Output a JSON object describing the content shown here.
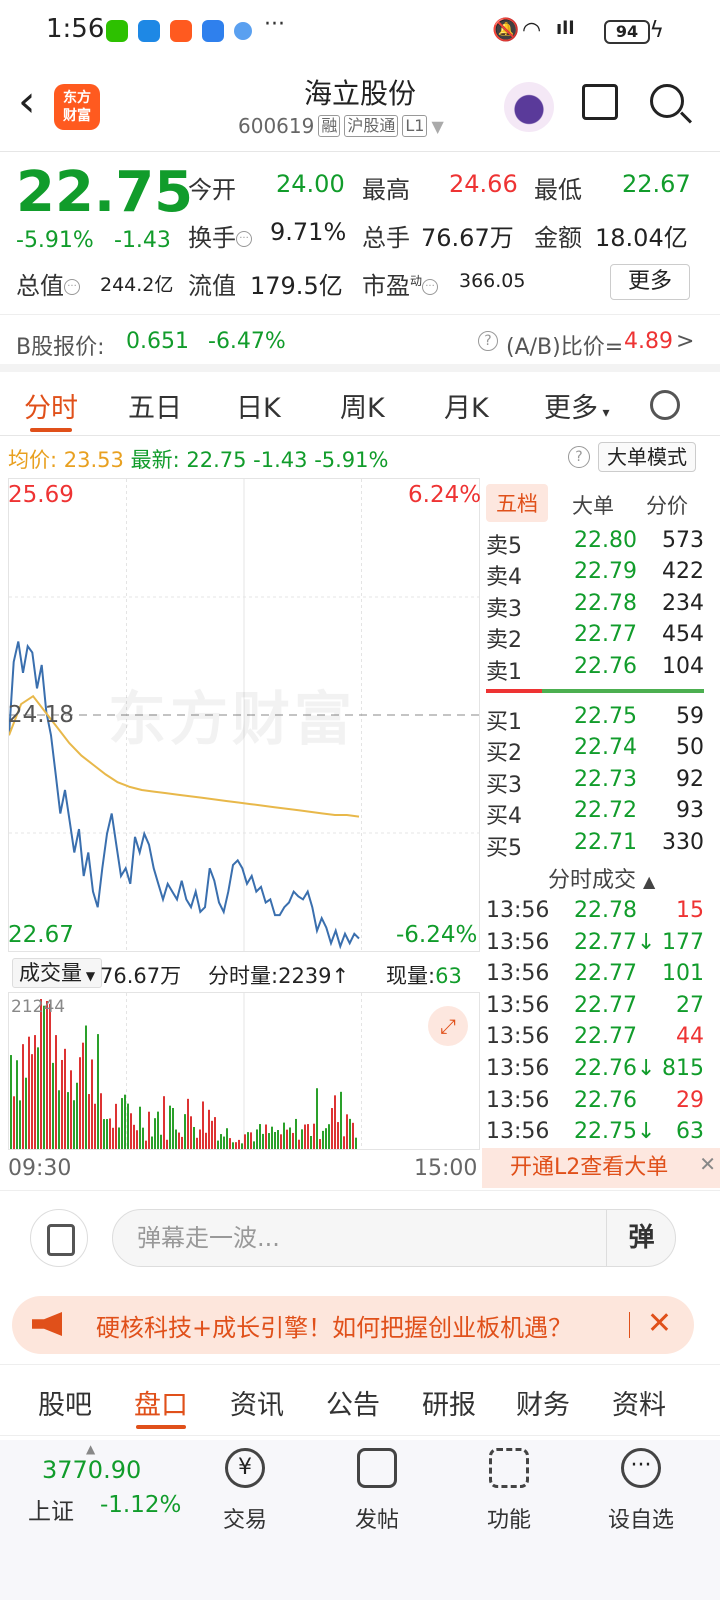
{
  "status_bar": {
    "time": "1:56",
    "battery": "94",
    "more": "···"
  },
  "header": {
    "title": "海立股份",
    "code": "600619",
    "tag_margin": "融",
    "tag_connect": "沪股通",
    "tag_level": "L1",
    "logo_line1": "东方",
    "logo_line2": "财富"
  },
  "quote": {
    "price": "22.75",
    "change_pct": "-5.91%",
    "change": "-1.43",
    "open_label": "今开",
    "open": "24.00",
    "high_label": "最高",
    "high": "24.66",
    "low_label": "最低",
    "low": "22.67",
    "turnover_label": "换手",
    "turnover": "9.71%",
    "volume_label": "总手",
    "volume": "76.67万",
    "amount_label": "金额",
    "amount": "18.04亿",
    "mktcap_label": "总值",
    "mktcap": "244.2亿",
    "float_label": "流值",
    "float": "179.5亿",
    "pe_label": "市盈",
    "pe_sup": "动",
    "pe": "366.05",
    "more_button": "更多"
  },
  "b_share": {
    "label": "B股报价:",
    "price": "0.651",
    "pct": "-6.47%",
    "ratio_label": "(A/B)比价=",
    "ratio": "4.89",
    "arrow": ">"
  },
  "chart_tabs": [
    "分时",
    "五日",
    "日K",
    "周K",
    "月K",
    "更多"
  ],
  "summary": {
    "avg_label": "均价:",
    "avg": "23.53",
    "latest_label": "最新:",
    "latest": "22.75",
    "chg": "-1.43",
    "pct": "-5.91%",
    "big_order_btn": "大单模式"
  },
  "chart_labels": {
    "top_price": "25.69",
    "top_pct": "6.24%",
    "mid_price": "24.18",
    "bottom_price": "22.67",
    "bottom_pct": "-6.24%",
    "watermark": "东方财富"
  },
  "chart_data": {
    "type": "line",
    "x_range": [
      "09:30",
      "15:00"
    ],
    "ylim": [
      22.67,
      25.69
    ],
    "prev_close": 24.18,
    "series": [
      {
        "name": "price",
        "color": "#3a6fae",
        "values": [
          24.05,
          24.52,
          24.65,
          24.45,
          24.62,
          24.58,
          24.35,
          24.5,
          24.2,
          24.05,
          23.8,
          23.55,
          23.7,
          23.5,
          23.3,
          23.45,
          23.15,
          23.3,
          23.05,
          22.95,
          23.2,
          23.42,
          23.55,
          23.35,
          23.15,
          23.2,
          23.1,
          23.4,
          23.3,
          23.42,
          23.35,
          23.2,
          23.1,
          23.0,
          23.1,
          23.05,
          23.0,
          23.12,
          23.0,
          22.95,
          23.05,
          22.92,
          22.95,
          23.2,
          23.12,
          22.98,
          22.92,
          23.05,
          23.22,
          23.25,
          23.2,
          23.1,
          23.15,
          23.05,
          23.08,
          22.98,
          23.0,
          22.9,
          22.9,
          22.95,
          22.98,
          23.05,
          23.02,
          23.0,
          23.05,
          22.95,
          22.8,
          22.88,
          22.82,
          22.72,
          22.8,
          22.7,
          22.78,
          22.72,
          22.78,
          22.75
        ]
      },
      {
        "name": "avg",
        "color": "#e8b84a",
        "values": [
          24.05,
          24.25,
          24.3,
          24.2,
          24.1,
          24.0,
          23.92,
          23.86,
          23.8,
          23.75,
          23.72,
          23.7,
          23.69,
          23.68,
          23.67,
          23.66,
          23.65,
          23.64,
          23.63,
          23.62,
          23.61,
          23.6,
          23.59,
          23.58,
          23.57,
          23.56,
          23.55,
          23.54,
          23.54,
          23.53
        ]
      }
    ],
    "volume": {
      "label": "成交量",
      "total": "76.67万",
      "minute_label": "分时量:",
      "minute": "2239",
      "current_label": "现量:",
      "current": "63",
      "max_label": "21244",
      "max": 21244
    },
    "grid": true
  },
  "order_book": {
    "tabs": [
      "五档",
      "大单",
      "分价"
    ],
    "asks": [
      {
        "label": "卖5",
        "price": "22.80",
        "vol": "573"
      },
      {
        "label": "卖4",
        "price": "22.79",
        "vol": "422"
      },
      {
        "label": "卖3",
        "price": "22.78",
        "vol": "234"
      },
      {
        "label": "卖2",
        "price": "22.77",
        "vol": "454"
      },
      {
        "label": "卖1",
        "price": "22.76",
        "vol": "104"
      }
    ],
    "bids": [
      {
        "label": "买1",
        "price": "22.75",
        "vol": "59"
      },
      {
        "label": "买2",
        "price": "22.74",
        "vol": "50"
      },
      {
        "label": "买3",
        "price": "22.73",
        "vol": "92"
      },
      {
        "label": "买4",
        "price": "22.72",
        "vol": "93"
      },
      {
        "label": "买5",
        "price": "22.71",
        "vol": "330"
      }
    ],
    "ticks_header": "分时成交",
    "ticks": [
      {
        "time": "13:56",
        "price": "22.78",
        "vol": "15",
        "color": "#e33"
      },
      {
        "time": "13:56",
        "price": "22.77↓",
        "vol": "177",
        "color": "#119c2b"
      },
      {
        "time": "13:56",
        "price": "22.77",
        "vol": "101",
        "color": "#119c2b"
      },
      {
        "time": "13:56",
        "price": "22.77",
        "vol": "27",
        "color": "#119c2b"
      },
      {
        "time": "13:56",
        "price": "22.77",
        "vol": "44",
        "color": "#e33"
      },
      {
        "time": "13:56",
        "price": "22.76↓",
        "vol": "815",
        "color": "#119c2b"
      },
      {
        "time": "13:56",
        "price": "22.76",
        "vol": "29",
        "color": "#e33"
      },
      {
        "time": "13:56",
        "price": "22.75↓",
        "vol": "63",
        "color": "#119c2b"
      }
    ],
    "l2_promo": "开通L2查看大单",
    "l2_close": "✕"
  },
  "time_axis": {
    "start": "09:30",
    "end": "15:00"
  },
  "danmaku": {
    "placeholder": "弹幕走一波...",
    "button": "弹"
  },
  "banner": {
    "text": "硬核科技+成长引擎！如何把握创业板机遇？",
    "close": "✕"
  },
  "bottom_tabs": [
    "股吧",
    "盘口",
    "资讯",
    "公告",
    "研报",
    "财务",
    "资料"
  ],
  "dock": {
    "index_value": "3770.90",
    "index_name": "上证",
    "index_pct": "-1.12%",
    "items": [
      "交易",
      "发帖",
      "功能",
      "设自选"
    ]
  },
  "colors": {
    "up": "#e33",
    "down": "#119c2b",
    "accent": "#e0501a",
    "avg_line": "#e8b84a",
    "price_line": "#3a6fae"
  }
}
